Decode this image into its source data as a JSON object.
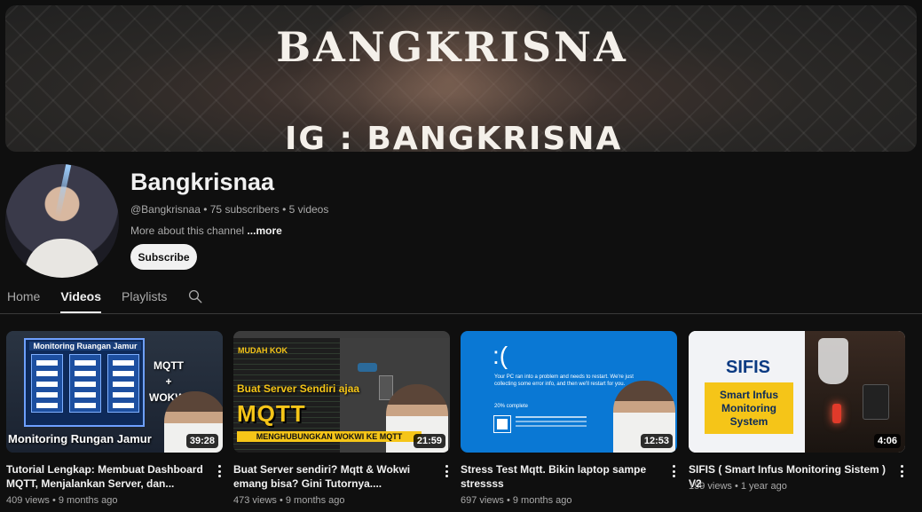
{
  "banner": {
    "title": "BANGKRISNA",
    "ig": "IG : BANGKRISNA"
  },
  "channel": {
    "name": "Bangkrisnaa",
    "meta": "@Bangkrisnaa • 75 subscribers • 5 videos",
    "about": "More about this channel",
    "more": "...more",
    "subscribe": "Subscribe"
  },
  "tabs": {
    "home": "Home",
    "videos": "Videos",
    "playlists": "Playlists",
    "search_icon": "search-icon"
  },
  "videos": [
    {
      "title": "Tutorial Lengkap: Membuat Dashboard MQTT, Menjalankan Server, dan...",
      "meta": "409 views • 9 months ago",
      "duration": "39:28",
      "thumb_text": {
        "panel_title": "Monitoring Ruangan Jamur",
        "caption": "Monitoring Rungan Jamur",
        "mqtt": "MQTT",
        "plus": "+",
        "wokwi": "WOKWI"
      }
    },
    {
      "title": "Buat Server sendiri? Mqtt & Wokwi emang bisa? Gini Tutornya....",
      "meta": "473 views • 9 months ago",
      "duration": "21:59",
      "thumb_text": {
        "mudah": "MUDAH KOK",
        "buat": "Buat Server Sendiri ajaa",
        "mqtt": "MQTT",
        "strip": "MENGHUBUNGKAN WOKWI KE MQTT"
      }
    },
    {
      "title": "Stress Test Mqtt. Bikin laptop sampe stressss",
      "meta": "697 views • 9 months ago",
      "duration": "12:53",
      "thumb_text": {
        "sad": ":(",
        "bsod": "Your PC ran into a problem and needs to restart. We're just collecting some error info, and then we'll restart for you.",
        "pct": "20% complete"
      }
    },
    {
      "title": "SIFIS ( Smart Infus Monitoring Sistem ) V2",
      "meta": "159 views • 1 year ago",
      "duration": "4:06",
      "thumb_text": {
        "sifis": "SIFIS",
        "box": "Smart Infus Monitoring System"
      }
    }
  ]
}
